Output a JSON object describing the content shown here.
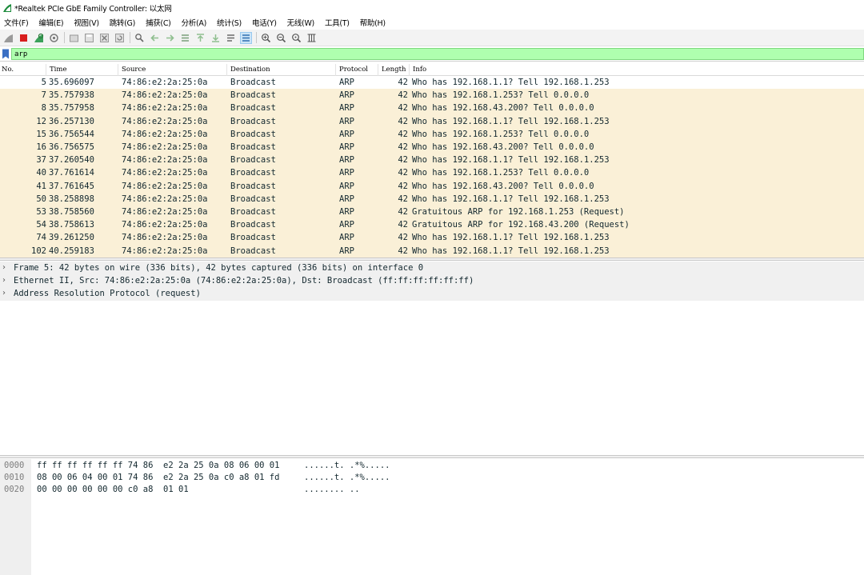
{
  "window": {
    "title": "*Realtek PCIe GbE Family Controller: 以太网"
  },
  "menu": [
    "文件(F)",
    "编辑(E)",
    "视图(V)",
    "跳转(G)",
    "捕获(C)",
    "分析(A)",
    "统计(S)",
    "电话(Y)",
    "无线(W)",
    "工具(T)",
    "帮助(H)"
  ],
  "toolbar_icons": [
    "shark-fin-start-icon",
    "stop-icon",
    "restart-icon",
    "capture-options-icon",
    "open-file-icon",
    "save-file-icon",
    "close-file-icon",
    "reload-icon",
    "find-packet-icon",
    "go-back-icon",
    "go-forward-icon",
    "go-to-packet-icon",
    "go-first-icon",
    "go-last-icon",
    "autoscroll-icon",
    "colorize-icon",
    "zoom-in-icon",
    "zoom-out-icon",
    "zoom-normal-icon",
    "resize-columns-icon"
  ],
  "filter": {
    "value": "arp"
  },
  "columns": [
    "No.",
    "Time",
    "Source",
    "Destination",
    "Protocol",
    "Length",
    "Info"
  ],
  "packets": [
    {
      "no": "5",
      "time": "35.696097",
      "src": "74:86:e2:2a:25:0a",
      "dst": "Broadcast",
      "proto": "ARP",
      "len": "42",
      "info": "Who has 192.168.1.1? Tell 192.168.1.253"
    },
    {
      "no": "7",
      "time": "35.757938",
      "src": "74:86:e2:2a:25:0a",
      "dst": "Broadcast",
      "proto": "ARP",
      "len": "42",
      "info": "Who has 192.168.1.253? Tell 0.0.0.0"
    },
    {
      "no": "8",
      "time": "35.757958",
      "src": "74:86:e2:2a:25:0a",
      "dst": "Broadcast",
      "proto": "ARP",
      "len": "42",
      "info": "Who has 192.168.43.200? Tell 0.0.0.0"
    },
    {
      "no": "12",
      "time": "36.257130",
      "src": "74:86:e2:2a:25:0a",
      "dst": "Broadcast",
      "proto": "ARP",
      "len": "42",
      "info": "Who has 192.168.1.1? Tell 192.168.1.253"
    },
    {
      "no": "15",
      "time": "36.756544",
      "src": "74:86:e2:2a:25:0a",
      "dst": "Broadcast",
      "proto": "ARP",
      "len": "42",
      "info": "Who has 192.168.1.253? Tell 0.0.0.0"
    },
    {
      "no": "16",
      "time": "36.756575",
      "src": "74:86:e2:2a:25:0a",
      "dst": "Broadcast",
      "proto": "ARP",
      "len": "42",
      "info": "Who has 192.168.43.200? Tell 0.0.0.0"
    },
    {
      "no": "37",
      "time": "37.260540",
      "src": "74:86:e2:2a:25:0a",
      "dst": "Broadcast",
      "proto": "ARP",
      "len": "42",
      "info": "Who has 192.168.1.1? Tell 192.168.1.253"
    },
    {
      "no": "40",
      "time": "37.761614",
      "src": "74:86:e2:2a:25:0a",
      "dst": "Broadcast",
      "proto": "ARP",
      "len": "42",
      "info": "Who has 192.168.1.253? Tell 0.0.0.0"
    },
    {
      "no": "41",
      "time": "37.761645",
      "src": "74:86:e2:2a:25:0a",
      "dst": "Broadcast",
      "proto": "ARP",
      "len": "42",
      "info": "Who has 192.168.43.200? Tell 0.0.0.0"
    },
    {
      "no": "50",
      "time": "38.258898",
      "src": "74:86:e2:2a:25:0a",
      "dst": "Broadcast",
      "proto": "ARP",
      "len": "42",
      "info": "Who has 192.168.1.1? Tell 192.168.1.253"
    },
    {
      "no": "53",
      "time": "38.758560",
      "src": "74:86:e2:2a:25:0a",
      "dst": "Broadcast",
      "proto": "ARP",
      "len": "42",
      "info": "Gratuitous ARP for 192.168.1.253 (Request)"
    },
    {
      "no": "54",
      "time": "38.758613",
      "src": "74:86:e2:2a:25:0a",
      "dst": "Broadcast",
      "proto": "ARP",
      "len": "42",
      "info": "Gratuitous ARP for 192.168.43.200 (Request)"
    },
    {
      "no": "74",
      "time": "39.261250",
      "src": "74:86:e2:2a:25:0a",
      "dst": "Broadcast",
      "proto": "ARP",
      "len": "42",
      "info": "Who has 192.168.1.1? Tell 192.168.1.253"
    },
    {
      "no": "102",
      "time": "40.259183",
      "src": "74:86:e2:2a:25:0a",
      "dst": "Broadcast",
      "proto": "ARP",
      "len": "42",
      "info": "Who has 192.168.1.1? Tell 192.168.1.253"
    }
  ],
  "details": [
    "Frame 5: 42 bytes on wire (336 bits), 42 bytes captured (336 bits) on interface 0",
    "Ethernet II, Src: 74:86:e2:2a:25:0a (74:86:e2:2a:25:0a), Dst: Broadcast (ff:ff:ff:ff:ff:ff)",
    "Address Resolution Protocol (request)"
  ],
  "bytes": [
    {
      "offset": "0000",
      "hex": "ff ff ff ff ff ff 74 86  e2 2a 25 0a 08 06 00 01",
      "ascii": "......t. .*%....."
    },
    {
      "offset": "0010",
      "hex": "08 00 06 04 00 01 74 86  e2 2a 25 0a c0 a8 01 fd",
      "ascii": "......t. .*%....."
    },
    {
      "offset": "0020",
      "hex": "00 00 00 00 00 00 c0 a8  01 01",
      "ascii": "........ .."
    }
  ],
  "colors": {
    "arp_row_bg": "#faf0d7",
    "filter_bg": "#afffaf",
    "text": "#12272e"
  }
}
